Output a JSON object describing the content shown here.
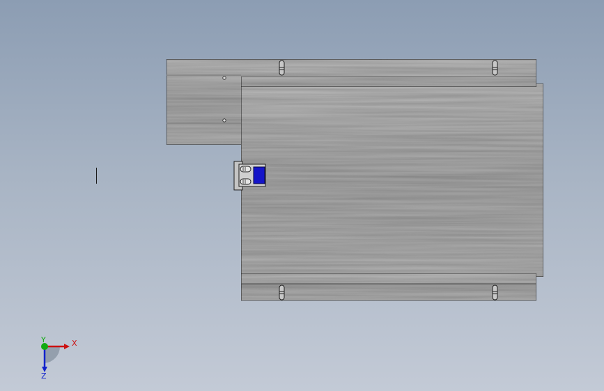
{
  "viewport": {
    "background_top": "#8c9db3",
    "background_bottom": "#c3cad6"
  },
  "model": {
    "part_color": "#a4a4a4",
    "edge_color": "#1e1e1e",
    "connector_color": "#1414c8"
  },
  "triad": {
    "x_label": "X",
    "y_label": "Y",
    "z_label": "Z",
    "x_color": "#cc1111",
    "y_color": "#11aa11",
    "z_color": "#1122cc"
  }
}
